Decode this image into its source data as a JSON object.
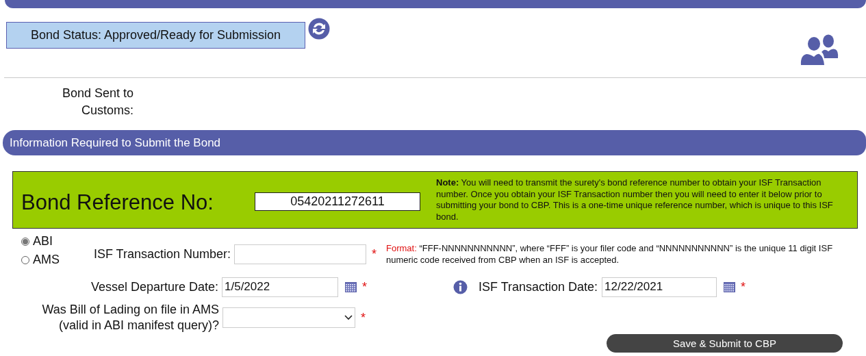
{
  "bond_status": {
    "text": "Bond Status: Approved/Ready for Submission"
  },
  "bond_sent": {
    "label": "Bond Sent to Customs:"
  },
  "section": {
    "title": "Information Required to Submit the Bond"
  },
  "reference": {
    "label": "Bond Reference No:",
    "value": "05420211272611",
    "note": "**Note:** You will need to transmit the surety's bond reference number to obtain your ISF Transaction number. Once you obtain your ISF Transaction number then you will need to enter it below prior to submitting your bond to CBP. This is a one-time unique reference number, which is unique to this ISF bond."
  },
  "filing_type": [
    {
      "label": "ABI",
      "selected": true
    },
    {
      "label": "AMS",
      "selected": false
    }
  ],
  "isf_number": {
    "label": "ISF Transaction Number:",
    "required_mark": "*"
  },
  "format_hint": {
    "lead": "Format:",
    "text": "“FFF-NNNNNNNNNNN”, where “FFF” is your filer code and “NNNNNNNNNNN” is the unique 11 digit ISF numeric code received from CBP when an ISF is accepted."
  },
  "vessel_departure_date": {
    "label": "Vessel Departure Date:",
    "value": "1/5/2022",
    "required_mark": "*"
  },
  "isf_transaction_date": {
    "label": "ISF Transaction Date:",
    "value": "12/22/2021",
    "required_mark": "*"
  },
  "bill_of_lading": {
    "label": "Was Bill of Lading on file in AMS (valid in ABI manifest query)?",
    "required_mark": "*"
  },
  "submit_button": {
    "label": "Save & Submit to CBP"
  }
}
